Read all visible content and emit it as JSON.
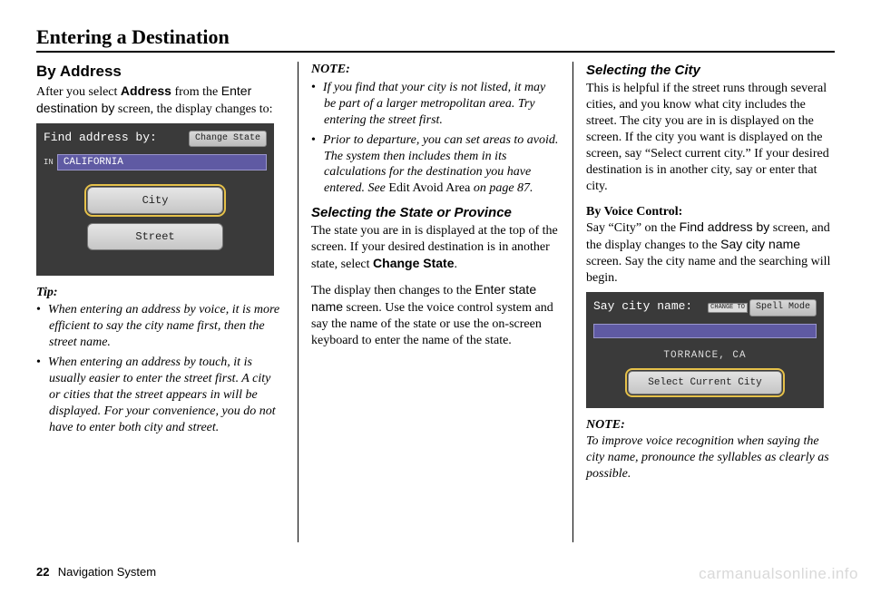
{
  "pageTitle": "Entering a Destination",
  "footer": {
    "pageNum": "22",
    "label": "Navigation System"
  },
  "watermark": "carmanualsonline.info",
  "col1": {
    "h2": "By Address",
    "intro": {
      "t1": "After you select ",
      "b1": "Address",
      "t2": " from the ",
      "s1": "Enter destination by",
      "t3": " screen, the display changes to:"
    },
    "screen": {
      "title": "Find address by:",
      "changeState": "Change State",
      "inLabel": "IN",
      "inValue": "CALIFORNIA",
      "btnCity": "City",
      "btnStreet": "Street"
    },
    "tipLabel": "Tip:",
    "tips": [
      "When entering an address by voice, it is more efficient to say the city name first, then the street name.",
      "When entering an address by touch, it is usually easier to enter the street first. A city or cities that the street appears in will be displayed. For your convenience, you do not have to enter both city and street."
    ]
  },
  "col2": {
    "noteLabel": "NOTE:",
    "notes": {
      "n1": "If you find that your city is not listed, it may be part of a larger metropolitan area. Try entering the street first.",
      "n2a": "Prior to departure, you can set areas to avoid. The system then includes them in its calculations for the destination you have entered. See ",
      "n2b": "Edit Avoid Area",
      "n2c": " on page 87."
    },
    "h3state": "Selecting the State or Province",
    "stateP1a": "The state you are in is displayed at the top of the screen. If your desired destination is in another state, select ",
    "stateP1b": "Change State",
    "stateP1c": ".",
    "stateP2a": "The display then changes to the ",
    "stateP2b": "Enter state name",
    "stateP2c": " screen. Use the voice control system and say the name of the state or use the on-screen keyboard to enter the name of the state."
  },
  "col3": {
    "h3city": "Selecting the City",
    "cityP1": "This is helpful if the street runs through several cities, and you know what city includes the street. The city you are in is displayed on the screen. If the city you want is displayed on the screen, say “Select current city.” If your desired destination is in another city, say or enter that city.",
    "voiceLabel": "By Voice Control:",
    "voiceP": {
      "t1": "Say “City” on the ",
      "s1": "Find address by",
      "t2": " screen, and the display changes to the ",
      "s2": "Say city name",
      "t3": " screen. Say the city name and the searching will begin."
    },
    "screen": {
      "title": "Say city name:",
      "changeToLabel": "CHANGE TO",
      "spellMode": "Spell Mode",
      "found": "TORRANCE, CA",
      "selectBtn": "Select Current City"
    },
    "noteLabel": "NOTE:",
    "noteText": "To improve voice recognition when saying the city name, pronounce the syllables as clearly as possible."
  }
}
